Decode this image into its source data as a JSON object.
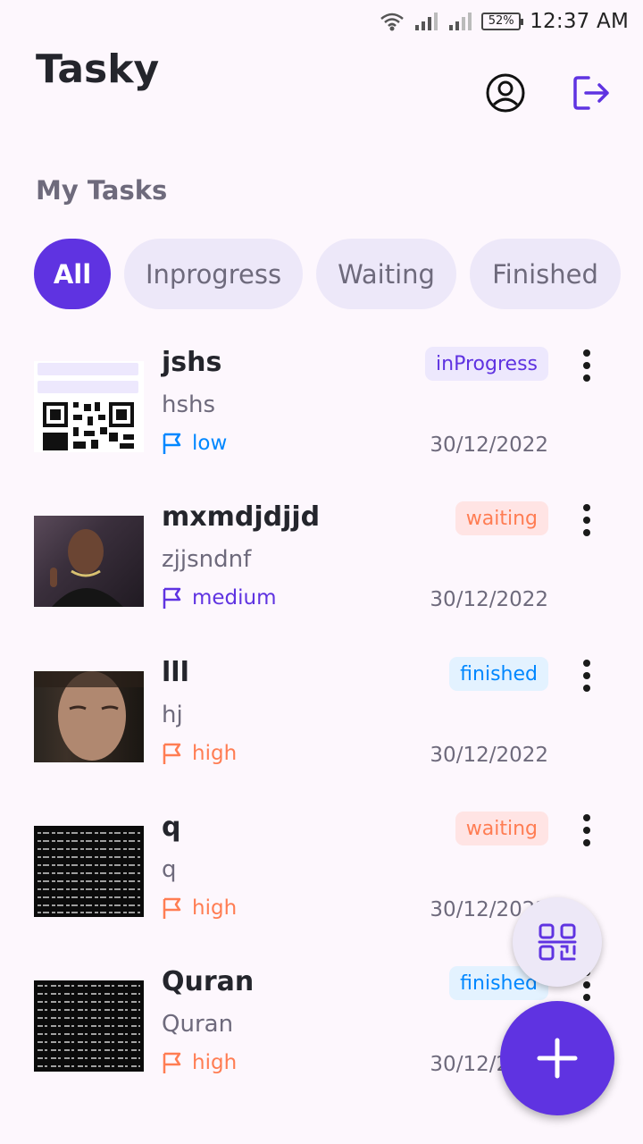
{
  "status_bar": {
    "battery": "52%",
    "time": "12:37 AM"
  },
  "header": {
    "title": "Tasky",
    "profile_icon": "person-circle-icon",
    "logout_icon": "logout-icon"
  },
  "section_title": "My Tasks",
  "filters": [
    {
      "label": "All",
      "active": true
    },
    {
      "label": "Inprogress",
      "active": false
    },
    {
      "label": "Waiting",
      "active": false
    },
    {
      "label": "Finished",
      "active": false
    }
  ],
  "tasks": [
    {
      "title": "jshs",
      "desc": "hshs",
      "priority": "low",
      "status": "inProgress",
      "date": "30/12/2022",
      "thumb": "qr-screenshot"
    },
    {
      "title": "mxmdjdjjd",
      "desc": "zjjsndnf",
      "priority": "medium",
      "status": "waiting",
      "date": "30/12/2022",
      "thumb": "photo-man-smiling"
    },
    {
      "title": "lll",
      "desc": "hj",
      "priority": "high",
      "status": "finished",
      "date": "30/12/2022",
      "thumb": "photo-man-face"
    },
    {
      "title": "q",
      "desc": "q",
      "priority": "high",
      "status": "waiting",
      "date": "30/12/2022",
      "thumb": "text-page-dark"
    },
    {
      "title": "Quran",
      "desc": "Quran",
      "priority": "high",
      "status": "finished",
      "date": "30/12/2022",
      "thumb": "text-page-dark"
    }
  ],
  "colors": {
    "primary": "#5f33e1",
    "low": "#0087ff",
    "medium": "#5f33e1",
    "high": "#ff7d53",
    "background": "#fdf7fd"
  },
  "fab": {
    "qr_icon": "qr-scan-icon",
    "add_icon": "plus-icon"
  }
}
